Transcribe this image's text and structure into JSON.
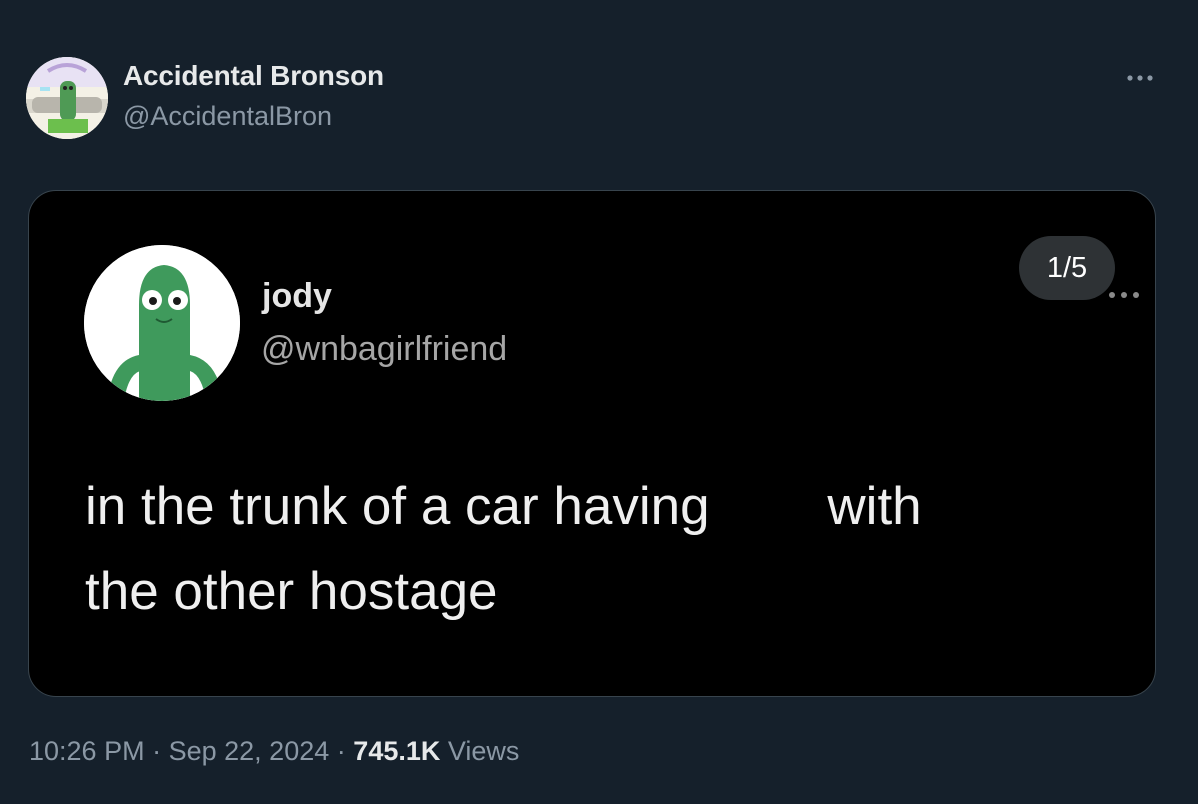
{
  "author": {
    "name": "Accidental Bronson",
    "handle": "@AccidentalBron",
    "avatar_icon": "gumby-car-avatar-icon"
  },
  "media": {
    "counter": "1/5",
    "inner_tweet": {
      "name": "jody",
      "handle": "@wnbagirlfriend",
      "avatar_icon": "gumby-avatar-icon",
      "text_line1": "in the trunk of a car having        with",
      "text_line2": "the other hostage"
    }
  },
  "meta": {
    "time": "10:26 PM",
    "separator": "·",
    "date": "Sep 22, 2024",
    "views_count": "745.1K",
    "views_label": "Views"
  },
  "colors": {
    "background": "#15202b",
    "primary_text": "#e7e9ea",
    "secondary_text": "#8b98a5",
    "border": "#38444d"
  }
}
